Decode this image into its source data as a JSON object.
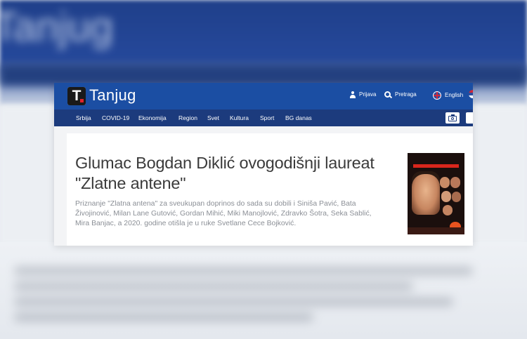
{
  "site": {
    "logo_letter": "T",
    "brand": "Tanjug"
  },
  "top_links": {
    "login": "Prijava",
    "search": "Pretraga",
    "language": "English"
  },
  "nav": {
    "items": [
      "Srbija",
      "COVID-19",
      "Ekonomija",
      "Region",
      "Svet",
      "Kultura",
      "Sport",
      "BG danas"
    ]
  },
  "article": {
    "headline": "Glumac Bogdan Diklić ovogodišnji laureat \"Zlatne antene\"",
    "lead": "Priznanje \"Zlatna antena\" za sveukupan doprinos do sada su dobili i Siniša Pavić, Bata Živojinović, Milan Lane Gutović, Gordan Mihić, Miki Manojlović, Zdravko Šotra, Seka Sablić, Mira Banjac, a 2020. godine otišla je u ruke Svetlane Cece Bojković."
  },
  "colors": {
    "topbar": "#1b4ea3",
    "navbar": "#1c3b7d",
    "headline": "#3b3b3b",
    "lead": "#8b8f96"
  },
  "icons": [
    "user-icon",
    "search-icon",
    "flag-uk-icon",
    "flag-rs-icon",
    "camera-icon"
  ]
}
